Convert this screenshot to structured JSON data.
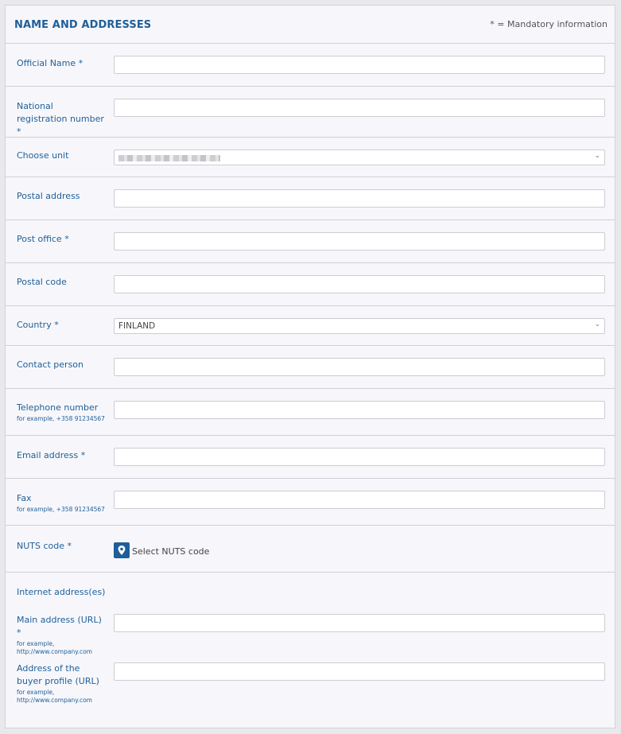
{
  "header": {
    "title": "NAME AND ADDRESSES",
    "mandatory_note": "* = Mandatory information"
  },
  "fields": {
    "official_name": {
      "label": "Official Name *",
      "value": ""
    },
    "national_registration": {
      "label": "National registration number *",
      "value": ""
    },
    "choose_unit": {
      "label": "Choose unit"
    },
    "postal_address": {
      "label": "Postal address",
      "value": ""
    },
    "post_office": {
      "label": "Post office *",
      "value": ""
    },
    "postal_code": {
      "label": "Postal code",
      "value": ""
    },
    "country": {
      "label": "Country *",
      "value": "FINLAND"
    },
    "contact_person": {
      "label": "Contact person",
      "value": ""
    },
    "telephone": {
      "label": "Telephone number",
      "hint": "for example, +358 91234567",
      "value": ""
    },
    "email": {
      "label": "Email address *",
      "value": ""
    },
    "fax": {
      "label": "Fax",
      "hint": "for example, +358 91234567",
      "value": ""
    },
    "nuts": {
      "label": "NUTS code *",
      "button_label": "Select NUTS code"
    },
    "internet_heading": "Internet address(es)",
    "main_address": {
      "label": "Main address (URL) *",
      "hint": "for example, http://www.company.com",
      "value": ""
    },
    "buyer_profile": {
      "label": "Address of the buyer profile (URL)",
      "hint": "for example, http://www.company.com",
      "value": ""
    }
  },
  "colors": {
    "accent": "#1f5f99",
    "panel_bg": "#f7f7fb",
    "border": "#cfcfd5"
  },
  "icons": {
    "nuts_button": "map-pin-icon",
    "select_arrow": "chevron-down-icon"
  }
}
